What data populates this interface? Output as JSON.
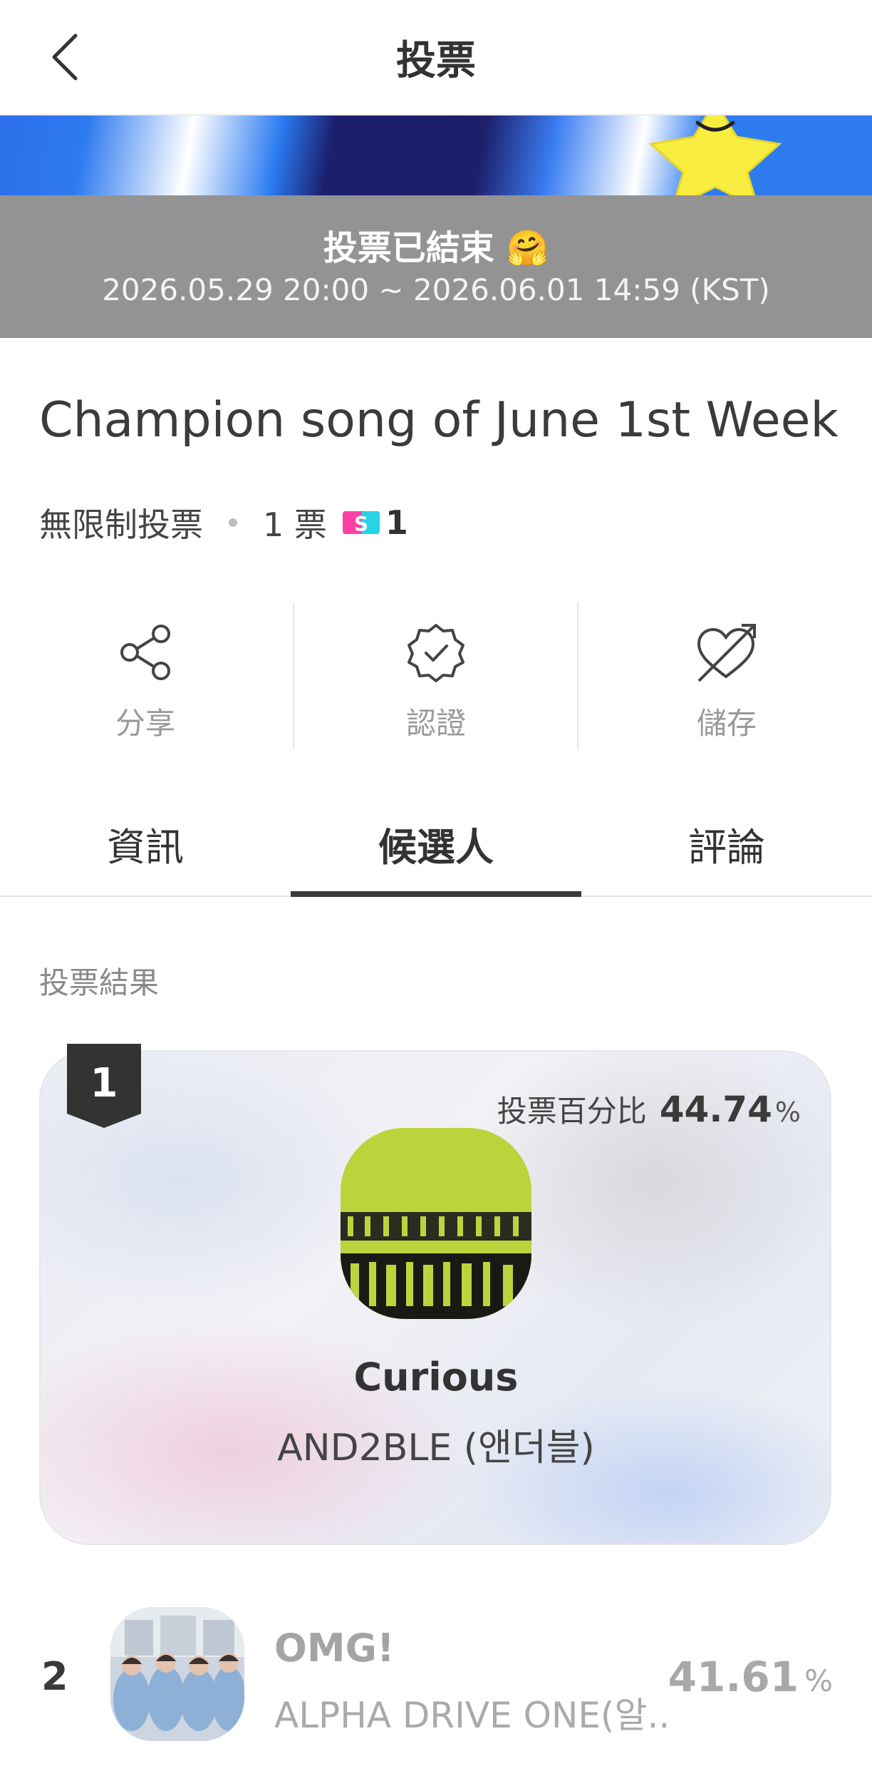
{
  "header": {
    "title": "投票"
  },
  "status": {
    "ended_text": "投票已結束 🤗",
    "period": "2026.05.29 20:00 ~ 2026.06.01 14:59 (KST)"
  },
  "vote": {
    "title": "Champion song of June 1st Week",
    "limit": "無限制投票",
    "cost": "1 票",
    "ticket_count": "1"
  },
  "actions": [
    {
      "label": "分享",
      "icon": "share-icon"
    },
    {
      "label": "認證",
      "icon": "verified-badge-icon"
    },
    {
      "label": "儲存",
      "icon": "heart-arrow-icon"
    }
  ],
  "tabs": [
    {
      "label": "資訊",
      "active": false
    },
    {
      "label": "候選人",
      "active": true
    },
    {
      "label": "評論",
      "active": false
    }
  ],
  "results": {
    "section_label": "投票結果",
    "percent_label": "投票百分比",
    "items": [
      {
        "rank": "1",
        "song": "Curious",
        "artist": "AND2BLE (앤더블)",
        "percent": "44.74",
        "unit": "%"
      },
      {
        "rank": "2",
        "song": "OMG!",
        "artist": "ALPHA DRIVE ONE(알...",
        "percent": "41.61",
        "unit": "%"
      }
    ]
  },
  "colors": {
    "status_bg": "#939393",
    "accent_pink": "#ff3fa4",
    "accent_cyan": "#27d3e6"
  }
}
